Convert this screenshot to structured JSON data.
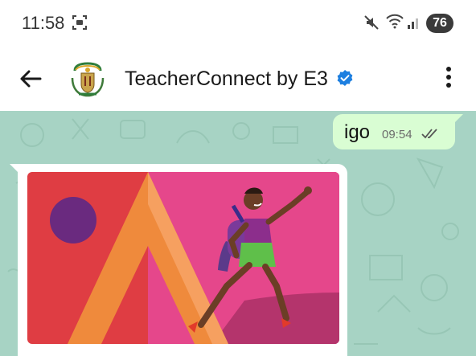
{
  "status_bar": {
    "time": "11:58",
    "battery": "76",
    "icons": [
      "screenshot-icon",
      "mute-icon",
      "wifi-icon",
      "signal-icon"
    ]
  },
  "header": {
    "title": "TeacherConnect by E3",
    "verified": true,
    "icons": [
      "back-arrow-icon",
      "coat-of-arms-icon",
      "verified-badge-icon",
      "more-vert-icon"
    ]
  },
  "chat": {
    "messages": [
      {
        "direction": "outgoing",
        "text": "igo",
        "time": "09:54",
        "status": "delivered"
      },
      {
        "direction": "incoming",
        "type": "image"
      }
    ]
  },
  "colors": {
    "chat_background": "#a7d3c4",
    "outgoing_bubble": "#d9fdd3",
    "incoming_bubble": "#ffffff",
    "verified_blue": "#1d7fe0",
    "banner_red": "#df3d43",
    "banner_pink": "#e5478b",
    "banner_orange": "#ef8a3c",
    "banner_purple": "#6a2a7f"
  }
}
